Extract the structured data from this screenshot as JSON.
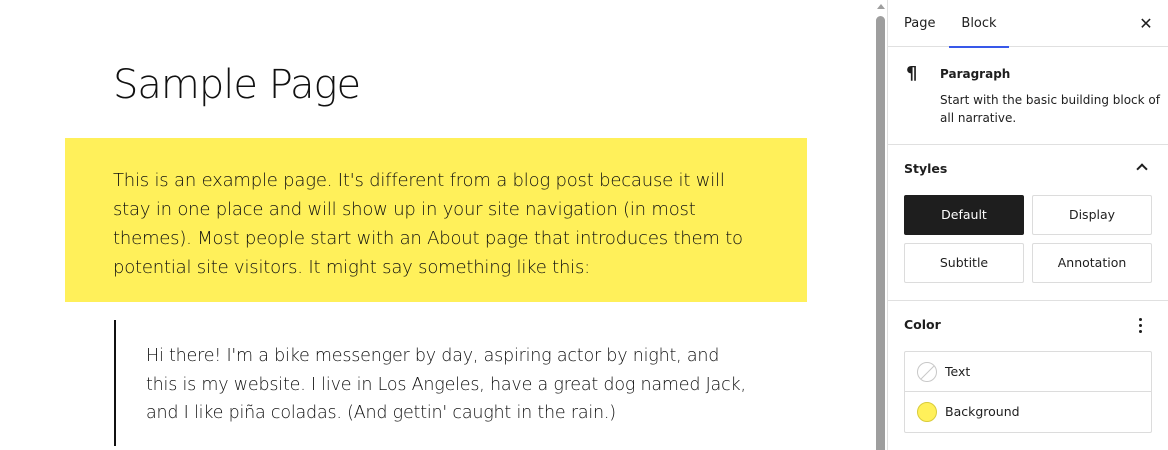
{
  "canvas": {
    "page_title": "Sample Page",
    "paragraph": "This is an example page. It's different from a blog post because it will stay in one place and will show up in your site navigation (in most themes). Most people start with an About page that introduces them to potential site visitors. It might say something like this:",
    "paragraph_background": "#fff05a",
    "quote": "Hi there! I'm a bike messenger by day, aspiring actor by night, and this is my website. I live in Los Angeles, have a great dog named Jack, and I like piña coladas. (And gettin' caught in the rain.)"
  },
  "sidebar": {
    "tabs": [
      {
        "label": "Page",
        "active": false
      },
      {
        "label": "Block",
        "active": true
      }
    ],
    "close_icon": "close-icon",
    "block": {
      "icon": "¶",
      "title": "Paragraph",
      "description": "Start with the basic building block of all narrative."
    },
    "styles": {
      "heading": "Styles",
      "options": [
        {
          "label": "Default",
          "active": true
        },
        {
          "label": "Display",
          "active": false
        },
        {
          "label": "Subtitle",
          "active": false
        },
        {
          "label": "Annotation",
          "active": false
        }
      ]
    },
    "color": {
      "heading": "Color",
      "items": [
        {
          "label": "Text",
          "swatch": "none"
        },
        {
          "label": "Background",
          "swatch": "#fff05a"
        }
      ]
    }
  },
  "colors": {
    "accent": "#3858e9",
    "highlight_yellow": "#fff05a",
    "dark": "#1e1e1e"
  }
}
